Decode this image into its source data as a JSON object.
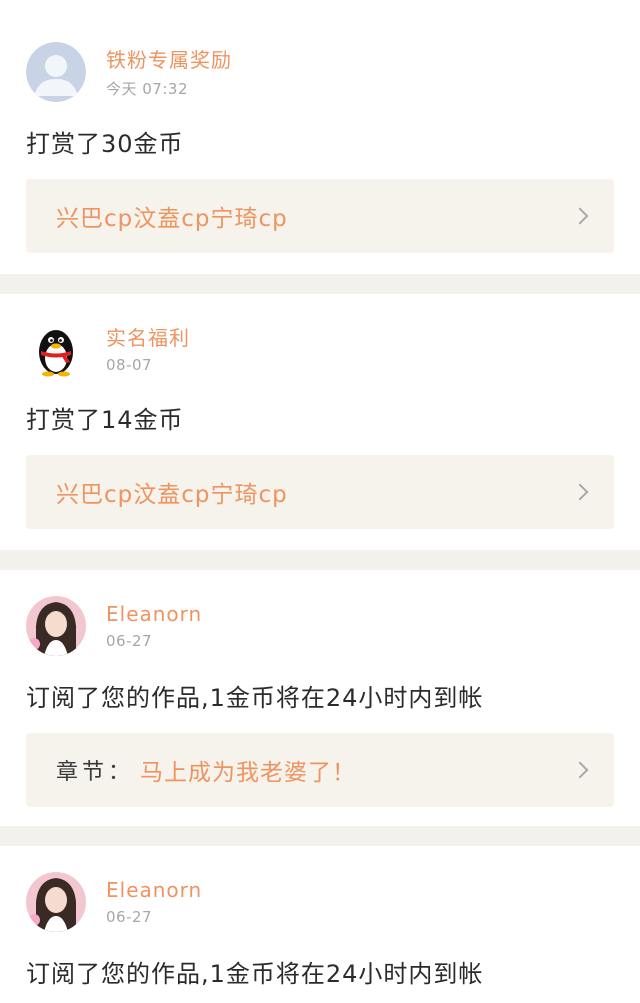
{
  "feed": [
    {
      "user": "铁粉专属奖励",
      "time": "今天 07:32",
      "avatar_icon": "default-user-avatar",
      "action": "打赏了30金币",
      "work": {
        "prefix": "",
        "title": "兴巴cp汶盍cp宁琦cp"
      }
    },
    {
      "user": "实名福利",
      "time": "08-07",
      "avatar_icon": "qq-penguin-icon",
      "action": "打赏了14金币",
      "work": {
        "prefix": "",
        "title": "兴巴cp汶盍cp宁琦cp"
      }
    },
    {
      "user": "Eleanorn",
      "time": "06-27",
      "avatar_icon": "user-photo",
      "action": "订阅了您的作品,1金币将在24小时内到帐",
      "work": {
        "prefix": "章节：",
        "title": "马上成为我老婆了！"
      }
    },
    {
      "user": "Eleanorn",
      "time": "06-27",
      "avatar_icon": "user-photo",
      "action": "订阅了您的作品,1金币将在24小时内到帐"
    }
  ],
  "colors": {
    "accent": "#ef9460",
    "tab_indicator": "#e9739a",
    "card_bg": "#f5f3ec",
    "divider": "#f3f1ee"
  }
}
